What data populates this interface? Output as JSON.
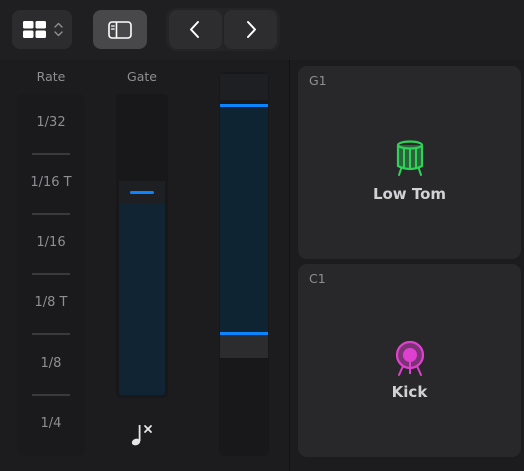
{
  "toolbar": {
    "layout_icon": "grid-icon",
    "stepper_icon": "chevron-updown-icon",
    "sidebar_icon": "sidebar-icon",
    "prev_icon": "chevron-left-icon",
    "next_icon": "chevron-right-icon"
  },
  "rate": {
    "label": "Rate",
    "items": [
      "1/32",
      "1/16 T",
      "1/16",
      "1/8 T",
      "1/8",
      "1/4"
    ]
  },
  "gate": {
    "label": "Gate",
    "level": 0.68,
    "tie_icon": "note-tie-icon"
  },
  "range": {
    "upper_level": 0.92,
    "lower_level": 0.32
  },
  "pads": [
    {
      "note": "G1",
      "name": "Low Tom",
      "icon": "tom-drum-icon",
      "color": "#30d158"
    },
    {
      "note": "C1",
      "name": "Kick",
      "icon": "kick-drum-icon",
      "color": "#e040d0"
    }
  ],
  "colors": {
    "accent": "#0a84ff",
    "background": "#1c1c1e",
    "pad": "#28282a"
  }
}
